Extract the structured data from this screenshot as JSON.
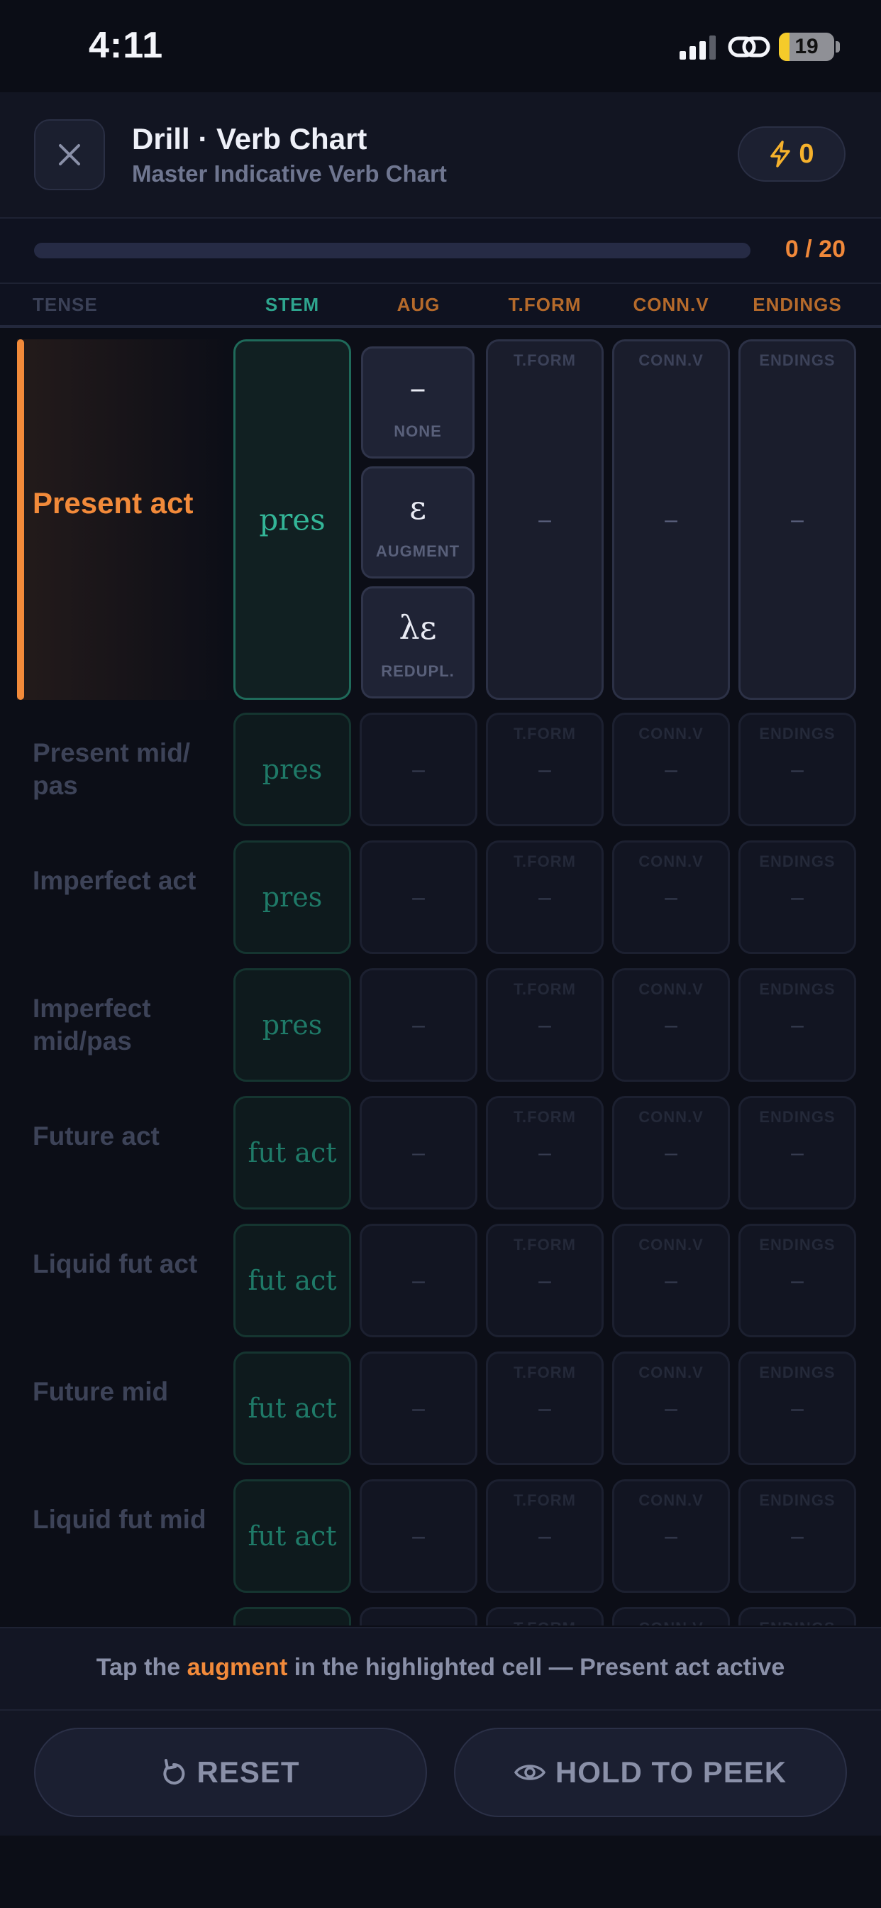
{
  "status_bar": {
    "time": "4:11",
    "battery": "19",
    "battery_level": 0.19
  },
  "header": {
    "title": "Drill · Verb Chart",
    "subtitle": "Master Indicative Verb Chart",
    "xp_value": "0",
    "icons": {
      "close": "close-icon",
      "xp": "lightning-icon"
    }
  },
  "progress": {
    "text": "0 / 20",
    "value": 0,
    "total": 20
  },
  "columns": {
    "tense": "TENSE",
    "stem": "STEM",
    "aug": "AUG",
    "tform": "T.FORM",
    "conn": "CONN.V",
    "endings": "ENDINGS"
  },
  "empty_mark": "–",
  "augment_options": [
    {
      "glyph": "–",
      "label": "NONE"
    },
    {
      "glyph": "ε",
      "label": "AUGMENT"
    },
    {
      "glyph": "λε",
      "label": "REDUPL."
    }
  ],
  "rows": [
    {
      "tense": "Present act",
      "stem": "pres",
      "active": true
    },
    {
      "tense": "Present mid/ pas",
      "stem": "pres"
    },
    {
      "tense": "Imperfect act",
      "stem": "pres"
    },
    {
      "tense": "Imperfect mid/pas",
      "stem": "pres"
    },
    {
      "tense": "Future act",
      "stem": "fut act"
    },
    {
      "tense": "Liquid fut act",
      "stem": "fut act"
    },
    {
      "tense": "Future mid",
      "stem": "fut act"
    },
    {
      "tense": "Liquid fut mid",
      "stem": "fut act"
    },
    {
      "tense": "",
      "stem": ""
    }
  ],
  "instruction": {
    "prefix": "Tap the ",
    "highlight": "augment",
    "suffix": " in the highlighted cell — Present act active"
  },
  "buttons": {
    "reset": "RESET",
    "peek": "HOLD TO PEEK",
    "icons": {
      "reset": "reset-icon",
      "peek": "eye-icon"
    }
  },
  "colors": {
    "accent": "#f28a3a",
    "stem": "#33b597",
    "xp": "#f5b12c",
    "background": "#0c0e17"
  }
}
